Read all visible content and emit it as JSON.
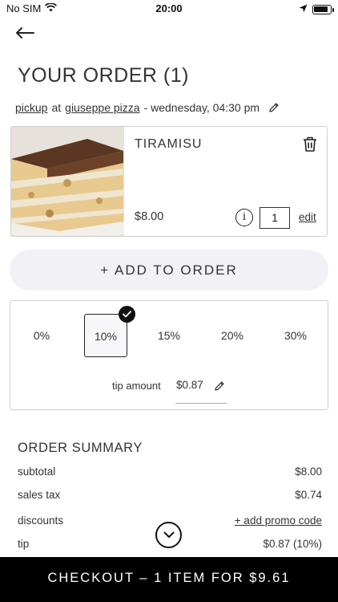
{
  "status_bar": {
    "carrier": "No SIM",
    "time": "20:00",
    "battery_level": 0.9
  },
  "header": {
    "title": "YOUR ORDER (1)"
  },
  "pickup": {
    "mode": "pickup",
    "at": "at",
    "restaurant": "giuseppe pizza",
    "datetime": "- wednesday, 04:30 pm"
  },
  "item": {
    "name": "TIRAMISU",
    "price": "$8.00",
    "info_label": "i",
    "quantity": "1",
    "edit_label": "edit"
  },
  "add_to_order_label": "+ ADD TO ORDER",
  "tip": {
    "options": [
      "0%",
      "10%",
      "15%",
      "20%",
      "30%"
    ],
    "selected": "10%",
    "amount_label": "tip amount",
    "amount": "$0.87"
  },
  "summary": {
    "title": "ORDER SUMMARY",
    "subtotal_label": "subtotal",
    "subtotal": "$8.00",
    "tax_label": "sales tax",
    "tax": "$0.74",
    "discounts_label": "discounts",
    "promo_link": "+ add promo code",
    "tip_label": "tip",
    "tip": "$0.87 (10%)"
  },
  "checkout_label": "CHECKOUT – 1 ITEM FOR $9.61",
  "colors": {
    "accent": "#000000",
    "button_bg": "#f2f2f6",
    "border": "#cfcfcf"
  }
}
